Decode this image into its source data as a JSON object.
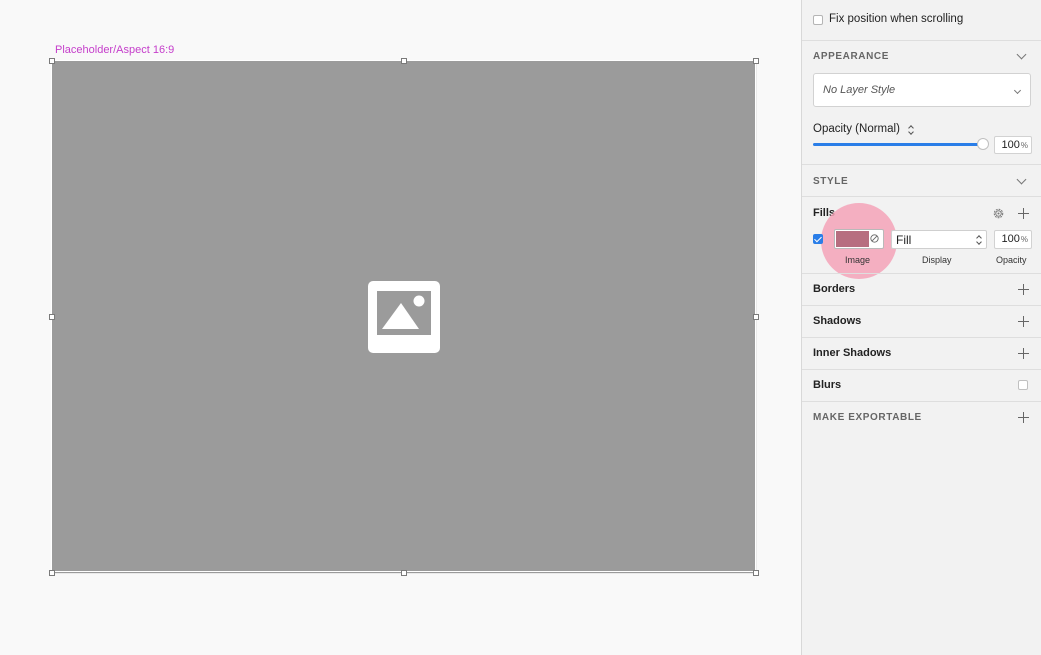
{
  "canvas": {
    "layer_label": "Placeholder/Aspect 16:9",
    "placeholder_color": "#9b9b9b",
    "label_color": "#c53ecb",
    "icon": "image-placeholder-icon"
  },
  "inspector": {
    "fix_position": {
      "label": "Fix position when scrolling",
      "checked": false
    },
    "appearance": {
      "title": "APPEARANCE",
      "layer_style": "No Layer Style",
      "opacity_label": "Opacity (Normal)",
      "opacity_value": "100",
      "opacity_unit": "%",
      "opacity_level": 1.0
    },
    "style": {
      "title": "STYLE",
      "fills": {
        "title": "Fills",
        "enabled": true,
        "swatch_color": "#b76e80",
        "display_mode": "Fill",
        "opacity_value": "100",
        "opacity_unit": "%",
        "captions": {
          "image": "Image",
          "display": "Display",
          "opacity": "Opacity"
        }
      },
      "borders": "Borders",
      "shadows": "Shadows",
      "inner_shadows": "Inner Shadows",
      "blurs": "Blurs"
    },
    "export": {
      "title": "MAKE EXPORTABLE"
    },
    "accent_color": "#2a7ee8"
  }
}
